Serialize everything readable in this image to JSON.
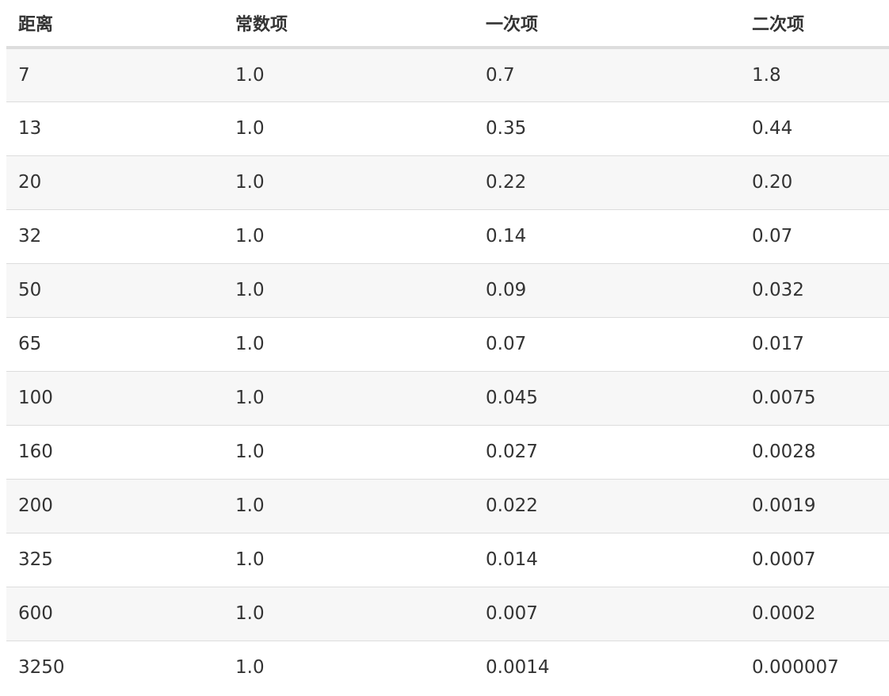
{
  "table": {
    "headers": [
      "距离",
      "常数项",
      "一次项",
      "二次项"
    ],
    "rows": [
      [
        "7",
        "1.0",
        "0.7",
        "1.8"
      ],
      [
        "13",
        "1.0",
        "0.35",
        "0.44"
      ],
      [
        "20",
        "1.0",
        "0.22",
        "0.20"
      ],
      [
        "32",
        "1.0",
        "0.14",
        "0.07"
      ],
      [
        "50",
        "1.0",
        "0.09",
        "0.032"
      ],
      [
        "65",
        "1.0",
        "0.07",
        "0.017"
      ],
      [
        "100",
        "1.0",
        "0.045",
        "0.0075"
      ],
      [
        "160",
        "1.0",
        "0.027",
        "0.0028"
      ],
      [
        "200",
        "1.0",
        "0.022",
        "0.0019"
      ],
      [
        "325",
        "1.0",
        "0.014",
        "0.0007"
      ],
      [
        "600",
        "1.0",
        "0.007",
        "0.0002"
      ],
      [
        "3250",
        "1.0",
        "0.0014",
        "0.000007"
      ]
    ]
  }
}
